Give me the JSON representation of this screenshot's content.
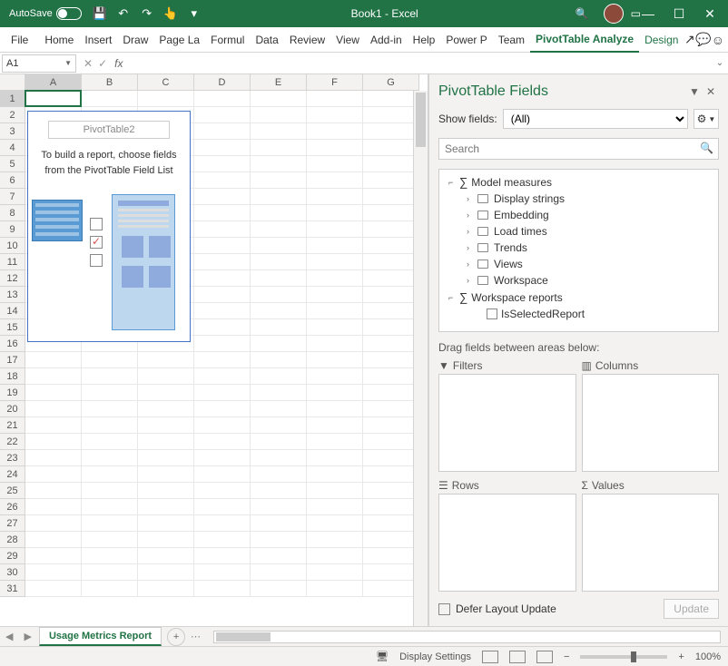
{
  "titlebar": {
    "autosave_label": "AutoSave",
    "doc_title": "Book1 - Excel"
  },
  "ribbon": {
    "tabs": [
      "File",
      "Home",
      "Insert",
      "Draw",
      "Page La",
      "Formul",
      "Data",
      "Review",
      "View",
      "Add-in",
      "Help",
      "Power P",
      "Team",
      "PivotTable Analyze",
      "Design"
    ]
  },
  "namebox": {
    "ref": "A1"
  },
  "fx_label": "fx",
  "columns": [
    "A",
    "B",
    "C",
    "D",
    "E",
    "F",
    "G"
  ],
  "row_count": 31,
  "active": {
    "col": 0,
    "row": 0
  },
  "pivot_placeholder": {
    "name": "PivotTable2",
    "msg": "To build a report, choose fields from the PivotTable Field List"
  },
  "panel": {
    "title": "PivotTable Fields",
    "show_label": "Show fields:",
    "show_value": "(All)",
    "search_placeholder": "Search",
    "tree": [
      {
        "type": "group",
        "label": "Model measures",
        "expanded": true,
        "children": [
          {
            "label": "Display strings"
          },
          {
            "label": "Embedding"
          },
          {
            "label": "Load times"
          },
          {
            "label": "Trends"
          },
          {
            "label": "Views"
          },
          {
            "label": "Workspace"
          }
        ]
      },
      {
        "type": "group",
        "label": "Workspace reports",
        "expanded": true,
        "children": [
          {
            "label": "IsSelectedReport",
            "leaf": true
          }
        ]
      }
    ],
    "areas_label": "Drag fields between areas below:",
    "areas": {
      "filters": "Filters",
      "columns": "Columns",
      "rows": "Rows",
      "values": "Values"
    },
    "defer_label": "Defer Layout Update",
    "update_label": "Update"
  },
  "sheets": {
    "active": "Usage Metrics Report"
  },
  "status": {
    "display_settings": "Display Settings",
    "zoom": "100%"
  }
}
